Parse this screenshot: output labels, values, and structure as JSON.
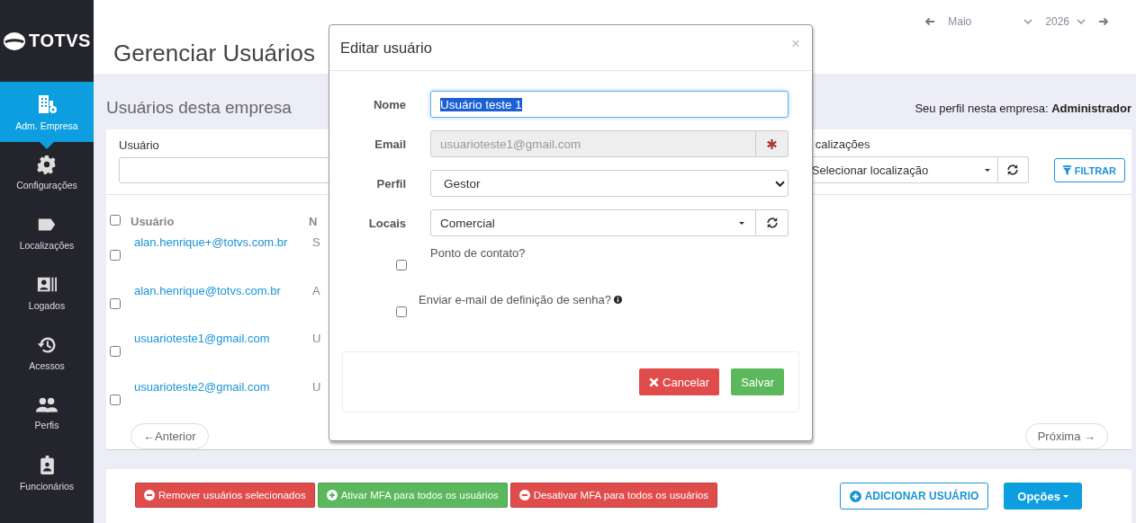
{
  "sidebar": {
    "logo": "TOTVS",
    "items": [
      {
        "label": "Adm. Empresa",
        "selected": true
      },
      {
        "label": "Configurações",
        "selected": false
      },
      {
        "label": "Localizações",
        "selected": false
      },
      {
        "label": "Logados",
        "selected": false
      },
      {
        "label": "Acessos",
        "selected": false
      },
      {
        "label": "Perfis",
        "selected": false
      },
      {
        "label": "Funcionários",
        "selected": false
      }
    ]
  },
  "date_nav": {
    "month": "Maio",
    "year": "2026"
  },
  "page_title": "Gerenciar Usuários",
  "section_title": "Usuários desta empresa",
  "profile_note": "Seu perfil nesta empresa: **Administrador**",
  "filters": {
    "user_label": "Usuário",
    "location_label": "calizações",
    "location_placeholder": "Selecionar localização",
    "filter_button": "FILTRAR"
  },
  "table": {
    "columns": [
      "Usuário",
      "N"
    ],
    "all_checked": false,
    "rows": [
      {
        "email": "alan.henrique+@totvs.com.br",
        "column_2": "S",
        "checked": false
      },
      {
        "email": "alan.henrique@totvs.com.br",
        "column_2": "A",
        "checked": false
      },
      {
        "email": "usuarioteste1@gmail.com",
        "column_2": "U",
        "checked": false
      },
      {
        "email": "usuarioteste2@gmail.com",
        "column_2": "U",
        "checked": false
      }
    ]
  },
  "pagination": {
    "previous": "←Anterior",
    "next": "Próxima →"
  },
  "actions": [
    {
      "label": "Remover usuários selecionados",
      "kind": "danger"
    },
    {
      "label": "Ativar MFA para todos os usuários",
      "kind": "success"
    },
    {
      "label": "Desativar MFA para todos os usuários",
      "kind": "danger"
    }
  ],
  "add_button": "ADICIONAR USUÁRIO",
  "options_button": "Opções",
  "dialog": {
    "title": "Editar usuário",
    "close": "×",
    "fields": [
      {
        "label": "Nome",
        "kind": "text",
        "value": "Usuário teste 1",
        "selected_text": true,
        "disabled": false
      },
      {
        "label": "Email",
        "kind": "addon",
        "value": "usuarioteste1@gmail.com",
        "selected_text": false,
        "disabled": true
      },
      {
        "label": "Perfil",
        "kind": "select",
        "value": "Gestor",
        "selected_text": false,
        "disabled": false
      },
      {
        "label": "Locais",
        "kind": "combo",
        "value": "Comercial",
        "selected_text": false,
        "disabled": false
      }
    ],
    "checkboxes": [
      {
        "label": "Ponto de contato?",
        "checked": false,
        "info": false
      },
      {
        "label": "Enviar e-mail de definição de senha?",
        "checked": false,
        "info": true
      }
    ],
    "cancel": "Cancelar",
    "save": "Salvar"
  }
}
